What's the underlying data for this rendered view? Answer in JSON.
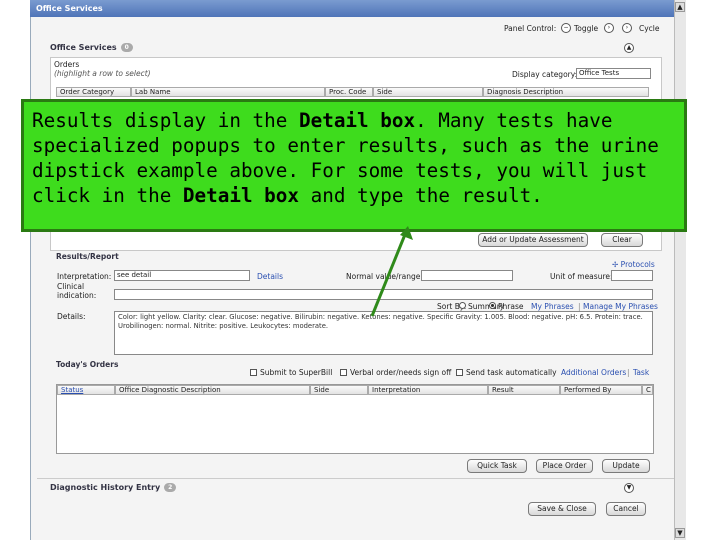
{
  "window": {
    "title": "Office Services"
  },
  "panel_control": {
    "label": "Panel Control:",
    "toggle": "Toggle",
    "cycle": "Cycle"
  },
  "office_services": {
    "title": "Office Services",
    "badge": "0"
  },
  "orders": {
    "title": "Orders",
    "hint": "(highlight a row to select)",
    "display_category_label": "Display category:",
    "display_category_value": "Office Tests",
    "columns": [
      "Order Category",
      "Lab Name",
      "Proc. Code",
      "Side",
      "Diagnosis Description"
    ]
  },
  "callout": {
    "part1": "Results display in the ",
    "bold1": "Detail box",
    "part2": ". Many tests have specialized popups to enter results, such as the urine dipstick example above. For some tests, you will just click in the ",
    "bold2": "Detail box",
    "part3": " and type the result."
  },
  "assessment": {
    "add_button": "Add or Update Assessment",
    "clear_button": "Clear"
  },
  "results": {
    "title": "Results/Report",
    "protocols": "Protocols",
    "interpretation_label": "Interpretation:",
    "interpretation_value": "see detail",
    "details_link": "Details",
    "normal_label": "Normal value/range:",
    "unit_label": "Unit of measure:",
    "clinical_label": "Clinical indication:",
    "sort_label": "Sort By:",
    "summary": "Summary",
    "phrase": "Phrase",
    "my_phrases": "My Phrases",
    "manage_phrases": "Manage My Phrases",
    "details_label": "Details:",
    "details_text": "Color: light yellow. Clarity: clear. Glucose: negative. Bilirubin: negative. Ketones: negative. Specific Gravity: 1.005. Blood: negative. pH: 6.5. Protein: trace. Urobilinogen: normal. Nitrite: positive. Leukocytes: moderate."
  },
  "todays_orders": {
    "title": "Today's Orders",
    "submit_superbill": "Submit to SuperBill",
    "verbal_order": "Verbal order/needs sign off",
    "send_task": "Send task automatically",
    "additional_orders": "Additional Orders",
    "task": "Task",
    "columns": [
      "Status",
      "Office Diagnostic Description",
      "Side",
      "Interpretation",
      "Result",
      "Performed By",
      "C"
    ]
  },
  "buttons": {
    "quick_task": "Quick Task",
    "place_order": "Place Order",
    "update": "Update",
    "save_close": "Save & Close",
    "cancel": "Cancel"
  },
  "diagnostic_history": {
    "title": "Diagnostic History Entry",
    "badge": "2"
  },
  "colors": {
    "callout_bg": "#3edc1d",
    "callout_border": "#2a7a12",
    "arrow": "#2f8a1a",
    "titlebar": "#4f74b8"
  }
}
